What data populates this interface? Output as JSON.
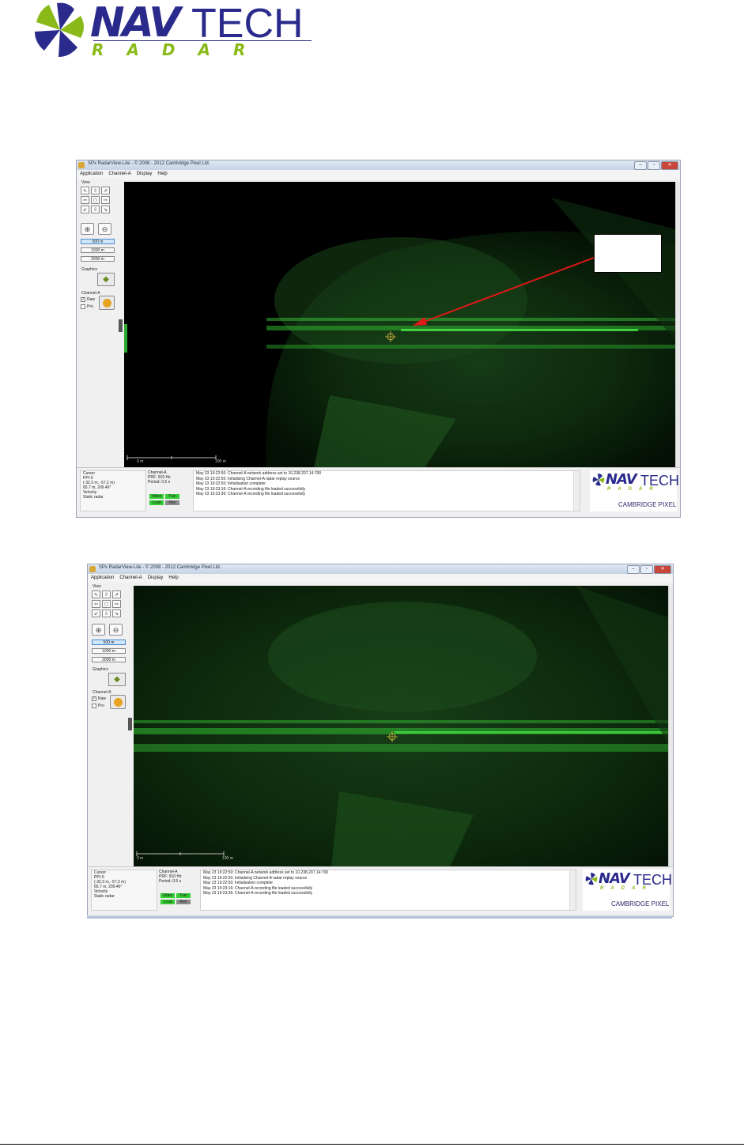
{
  "logo": {
    "nav": "NAV",
    "tech": "TECH",
    "radar": "RADAR"
  },
  "screenshots": [
    {
      "title": "SPx RadarView-Lite - © 2008 - 2012 Cambridge Pixel Ltd.",
      "menu": [
        "Application",
        "Channel-A",
        "Display",
        "Help"
      ],
      "panel": {
        "view_label": "View",
        "arrows": [
          "⇖",
          "⇧",
          "⇗",
          "⇦",
          "◻",
          "⇨",
          "⇙",
          "⇩",
          "⇘"
        ],
        "ranges": [
          "500 m",
          "1000 m",
          "2000 m"
        ],
        "graphics_label": "Graphics",
        "channel_label": "Channel-A",
        "raw_label": "Raw",
        "pro_label": "Pro"
      },
      "scale": {
        "left": "0 m",
        "right": "100 m"
      },
      "status": {
        "cursor_lines": [
          "Cursor",
          "PPI-0",
          "(-32.3 m, -57.2 m)",
          "65.7 m, 209.46°",
          "Velocity",
          "Static radar"
        ],
        "channel_lines": [
          "Channel-A",
          "PRF: 910 Hz",
          "Period: 0.5 s"
        ],
        "chips": [
          "Video",
          "Tran",
          "Load",
          "Rec"
        ]
      },
      "log": [
        "May 23 19:22:50: Channel-A network address set to 10.238.207.14:700",
        "May 23 19:22:50: Initialising Channel-A radar replay source",
        "May 23 19:22:50: Initialisation complete",
        "May 23 19:23:16: Channel-A recording file loaded successfully",
        "May 23 19:23:36: Channel-A recording file loaded successfully"
      ],
      "brand": {
        "nav": "NAV",
        "tech": "TECH",
        "radar": "RADAR",
        "cp": "CAMBRIDGE PIXEL"
      }
    },
    {
      "title": "SPx RadarView-Lite - © 2008 - 2012 Cambridge Pixel Ltd.",
      "menu": [
        "Application",
        "Channel-A",
        "Display",
        "Help"
      ],
      "panel": {
        "view_label": "View",
        "arrows": [
          "⇖",
          "⇧",
          "⇗",
          "⇦",
          "◻",
          "⇨",
          "⇙",
          "⇩",
          "⇘"
        ],
        "ranges": [
          "500 m",
          "1000 m",
          "2000 m"
        ],
        "graphics_label": "Graphics",
        "channel_label": "Channel-A",
        "raw_label": "Raw",
        "pro_label": "Pro"
      },
      "scale": {
        "left": "0 m",
        "right": "100 m"
      },
      "status": {
        "cursor_lines": [
          "Cursor",
          "PPI-0",
          "(-32.3 m, -57.2 m)",
          "65.7 m, 209.46°",
          "Velocity",
          "Static radar"
        ],
        "channel_lines": [
          "Channel-A",
          "PRF: 910 Hz",
          "Period: 0.5 s"
        ],
        "chips": [
          "Video",
          "Tran",
          "Load",
          "Rec"
        ]
      },
      "log": [
        "May 23 19:22:50: Channel-A network address set to 10.238.207.14:700",
        "May 23 19:22:50: Initialising Channel-A radar replay source",
        "May 23 19:22:50: Initialisation complete",
        "May 23 19:23:16: Channel-A recording file loaded successfully",
        "May 23 19:23:36: Channel-A recording file loaded successfully"
      ],
      "brand": {
        "nav": "NAV",
        "tech": "TECH",
        "radar": "RADAR",
        "cp": "CAMBRIDGE PIXEL"
      }
    }
  ],
  "colors": {
    "brand_blue": "#2a2a8c",
    "brand_green": "#8aba1a",
    "radar_green": "#3dd63d",
    "annotation_red": "#e01818"
  }
}
